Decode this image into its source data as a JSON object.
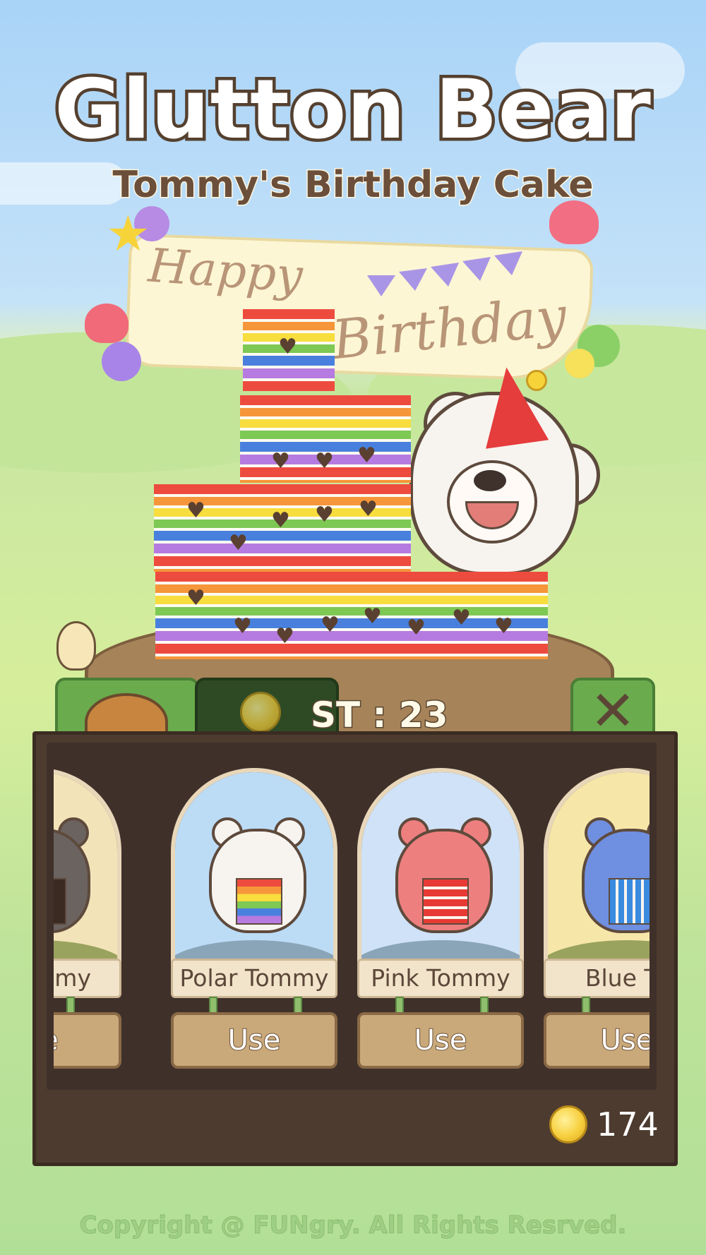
{
  "app": {
    "title": "Glutton Bear",
    "subtitle": "Tommy's Birthday Cake",
    "banner_line1": "Happy",
    "banner_line2": "Birthday"
  },
  "shop": {
    "cost_text": "ST : 23",
    "close_label": "✕",
    "balance": "174",
    "skins": [
      {
        "name": "n Tommy",
        "button": "Jse",
        "sky": "#f3e3b8",
        "fur": "#6b6360",
        "cake": "#3b2a22"
      },
      {
        "name": "Polar Tommy",
        "button": "Use",
        "sky": "#bcdcf6",
        "fur": "#f7f4f0",
        "cake": "rainbow"
      },
      {
        "name": "Pink Tommy",
        "button": "Use",
        "sky": "#cfe2f7",
        "fur": "#ee7f7f",
        "cake": "#e83a34"
      },
      {
        "name": "Blue To",
        "button": "Use",
        "sky": "#f6e7a8",
        "fur": "#6f8fe0",
        "cake": "#3a8be0"
      }
    ]
  },
  "footer": {
    "copyright": "Copyright @ FUNgry. All Rights Resrved."
  },
  "colors": {
    "panel": "#4d3b2f",
    "title_stroke": "#55402f",
    "leaf": "#6aab4d"
  }
}
